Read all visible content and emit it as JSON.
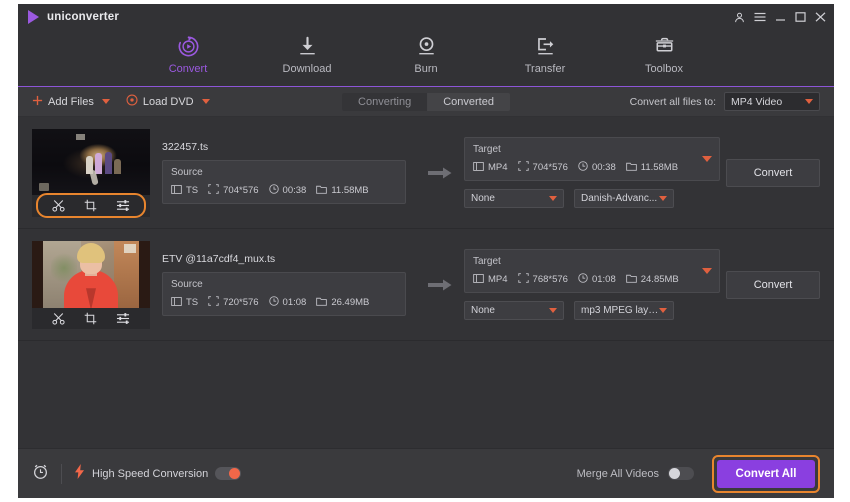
{
  "window": {
    "brand": "uniconverter",
    "controls": [
      {
        "name": "account-icon",
        "label": "account"
      },
      {
        "name": "menu-icon",
        "label": "menu"
      },
      {
        "name": "minimize-icon",
        "label": "minimize"
      },
      {
        "name": "maximize-icon",
        "label": "maximize"
      },
      {
        "name": "close-icon",
        "label": "close"
      }
    ]
  },
  "nav": {
    "items": [
      {
        "label": "Convert",
        "icon": "convert-icon",
        "active": true
      },
      {
        "label": "Download",
        "icon": "download-icon",
        "active": false
      },
      {
        "label": "Burn",
        "icon": "burn-icon",
        "active": false
      },
      {
        "label": "Transfer",
        "icon": "transfer-icon",
        "active": false
      },
      {
        "label": "Toolbox",
        "icon": "toolbox-icon",
        "active": false
      }
    ]
  },
  "toolbar": {
    "add_files": "Add Files",
    "load_dvd": "Load DVD",
    "tabs": [
      {
        "label": "Converting",
        "active": true
      },
      {
        "label": "Converted",
        "active": false
      }
    ],
    "convert_all_to_label": "Convert all files to:",
    "convert_all_to_value": "MP4 Video"
  },
  "list": {
    "source_title": "Source",
    "target_title": "Target",
    "convert_button": "Convert",
    "rows": [
      {
        "filename": "322457.ts",
        "thumb": "concert-stage",
        "tools_highlighted": true,
        "tools": [
          "trim-icon",
          "crop-icon",
          "effect-icon"
        ],
        "source": {
          "format": "TS",
          "resolution": "704*576",
          "duration": "00:38",
          "size": "11.58MB"
        },
        "target": {
          "format": "MP4",
          "resolution": "704*576",
          "duration": "00:38",
          "size": "11.58MB"
        },
        "subtitle_select": "None",
        "audio_select": "Danish-Advanc..."
      },
      {
        "filename": "ETV @11a7cdf4_mux.ts",
        "thumb": "news-anchor",
        "tools_highlighted": false,
        "tools": [
          "trim-icon",
          "crop-icon",
          "effect-icon"
        ],
        "source": {
          "format": "TS",
          "resolution": "720*576",
          "duration": "01:08",
          "size": "26.49MB"
        },
        "target": {
          "format": "MP4",
          "resolution": "768*576",
          "duration": "01:08",
          "size": "24.85MB"
        },
        "subtitle_select": "None",
        "audio_select": "mp3 MPEG laye..."
      }
    ]
  },
  "footer": {
    "timer_icon": "alarm-clock-icon",
    "high_speed_label": "High Speed Conversion",
    "high_speed_on": true,
    "merge_label": "Merge All Videos",
    "merge_on": false,
    "convert_all_button": "Convert All"
  },
  "colors": {
    "accent_purple": "#8a3fe0",
    "accent_orange": "#e8852e",
    "accent_red": "#e0603f",
    "window_bg": "#3a3a3d",
    "panel_bg": "#3d3d41"
  }
}
